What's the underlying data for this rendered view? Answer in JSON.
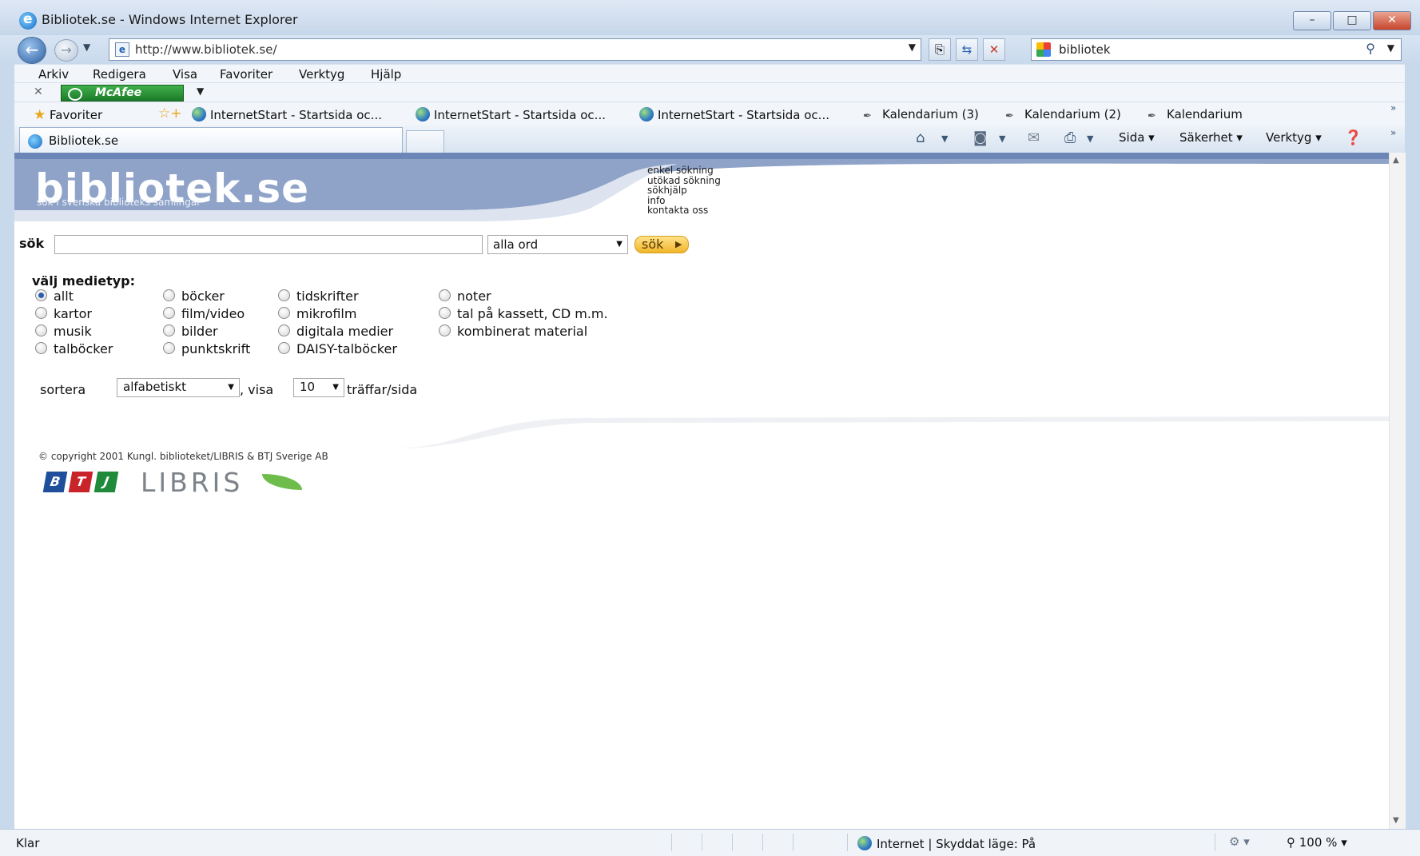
{
  "window": {
    "title": "Bibliotek.se - Windows Internet Explorer",
    "controls": {
      "minimize": "–",
      "maximize": "□",
      "close": "✕"
    }
  },
  "address": {
    "url": "http://www.bibliotek.se/",
    "search_value": "bibliotek"
  },
  "menubar": [
    "Arkiv",
    "Redigera",
    "Visa",
    "Favoriter",
    "Verktyg",
    "Hjälp"
  ],
  "toolbar": {
    "mcafee_label": "McAfee"
  },
  "favorites": {
    "label": "Favoriter",
    "items": [
      "InternetStart - Startsida oc...",
      "InternetStart - Startsida oc...",
      "InternetStart - Startsida oc...",
      "Kalendarium (3)",
      "Kalendarium (2)",
      "Kalendarium"
    ]
  },
  "tab": {
    "label": "Bibliotek.se"
  },
  "commandbar": {
    "page": "Sida",
    "security": "Säkerhet",
    "tools": "Verktyg"
  },
  "site": {
    "logo": "bibliotek.se",
    "tagline": "sök i svenska biblioteks samlingar",
    "top_links": [
      "enkel sökning",
      "utökad sökning",
      "sökhjälp",
      "info",
      "kontakta oss"
    ],
    "search": {
      "label": "sök",
      "mode": "alla ord",
      "button": "sök"
    },
    "media": {
      "title": "välj medietyp:",
      "options": [
        "allt",
        "böcker",
        "tidskrifter",
        "noter",
        "kartor",
        "film/video",
        "mikrofilm",
        "tal på kassett, CD m.m.",
        "musik",
        "bilder",
        "digitala medier",
        "kombinerat material",
        "talböcker",
        "punktskrift",
        "DAISY-talböcker"
      ],
      "selected": "allt"
    },
    "sort": {
      "label": "sortera",
      "value": "alfabetiskt",
      "show_label": ", visa",
      "per_page": "10",
      "per_page_suffix": "träffar/sida"
    },
    "copyright": "© copyright 2001 Kungl. biblioteket/LIBRIS & BTJ Sverige AB",
    "footer_logos": {
      "btj": [
        "B",
        "T",
        "J"
      ],
      "libris": "LIBRIS"
    }
  },
  "statusbar": {
    "status": "Klar",
    "zone": "Internet | Skyddat läge: På",
    "zoom": "100 %"
  },
  "colors": {
    "banner": "#8fa3c9",
    "accent_button": "#f0b52a",
    "btj_blue": "#1f4f9a",
    "btj_red": "#c8242a",
    "btj_green": "#1e8a3a",
    "libris_leaf": "#6ebc4a"
  }
}
